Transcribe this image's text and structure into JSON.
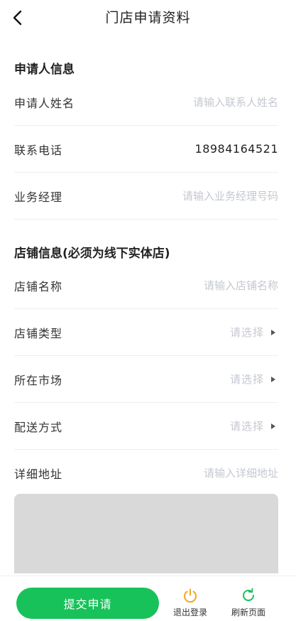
{
  "header": {
    "title": "门店申请资料"
  },
  "applicant_section": {
    "title": "申请人信息",
    "fields": [
      {
        "label": "申请人姓名",
        "value": "",
        "placeholder": "请输入联系人姓名"
      },
      {
        "label": "联系电话",
        "value": "18984164521"
      },
      {
        "label": "业务经理",
        "value": "",
        "placeholder": "请输入业务经理号码"
      }
    ]
  },
  "store_section": {
    "title": "店铺信息(必须为线下实体店)",
    "fields": [
      {
        "label": "店铺名称",
        "value": "",
        "placeholder": "请输入店铺名称"
      },
      {
        "label": "店铺类型",
        "select_text": "请选择"
      },
      {
        "label": "所在市场",
        "select_text": "请选择"
      },
      {
        "label": "配送方式",
        "select_text": "请选择"
      },
      {
        "label": "详细地址",
        "value": "",
        "placeholder": "请输入详细地址"
      }
    ]
  },
  "footer": {
    "submit_label": "提交申请",
    "logout_label": "退出登录",
    "refresh_label": "刷新页面"
  },
  "colors": {
    "accent": "#18c25a",
    "logout_icon": "#f5a623",
    "refresh_icon": "#18c25a",
    "placeholder": "#c4c8cf"
  },
  "icons": {
    "back": "chevron-left-icon",
    "select_arrow": "triangle-right-icon",
    "logout": "power-icon",
    "refresh": "refresh-icon"
  }
}
